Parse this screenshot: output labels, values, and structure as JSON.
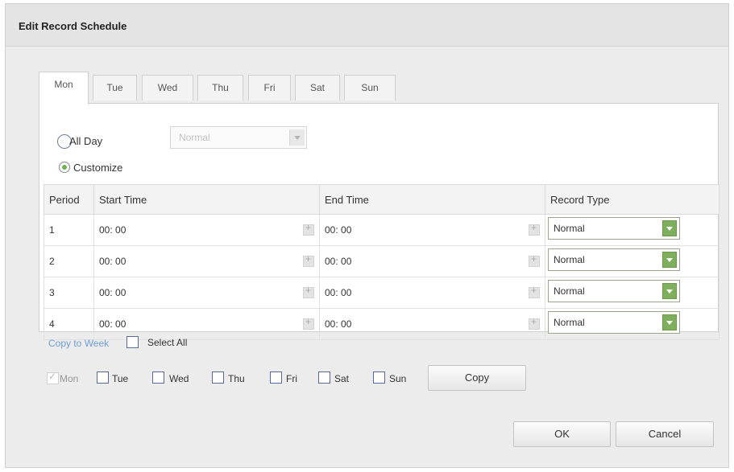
{
  "dialog": {
    "title": "Edit Record Schedule"
  },
  "tabs": [
    {
      "label": "Mon",
      "active": true
    },
    {
      "label": "Tue"
    },
    {
      "label": "Wed"
    },
    {
      "label": "Thu"
    },
    {
      "label": "Fri"
    },
    {
      "label": "Sat"
    },
    {
      "label": "Sun"
    }
  ],
  "mode": {
    "all_day_label": "All Day",
    "all_day_type": "Normal",
    "customize_label": "Customize",
    "selected": "Customize"
  },
  "table": {
    "headers": [
      "Period",
      "Start Time",
      "End Time",
      "Record Type"
    ],
    "rows": [
      {
        "period": "1",
        "start": "00: 00",
        "end": "00: 00",
        "type": "Normal"
      },
      {
        "period": "2",
        "start": "00: 00",
        "end": "00: 00",
        "type": "Normal"
      },
      {
        "period": "3",
        "start": "00: 00",
        "end": "00: 00",
        "type": "Normal"
      },
      {
        "period": "4",
        "start": "00: 00",
        "end": "00: 00",
        "type": "Normal"
      }
    ]
  },
  "copy": {
    "link_label": "Copy to Week",
    "select_all_label": "Select All",
    "days": [
      "Mon",
      "Tue",
      "Wed",
      "Thu",
      "Fri",
      "Sat",
      "Sun"
    ],
    "checked_day": "Mon",
    "copy_button": "Copy"
  },
  "footer": {
    "ok_label": "OK",
    "cancel_label": "Cancel"
  },
  "colors": {
    "accent_green": "#7fae5c",
    "link_blue": "#6d9fd6"
  }
}
